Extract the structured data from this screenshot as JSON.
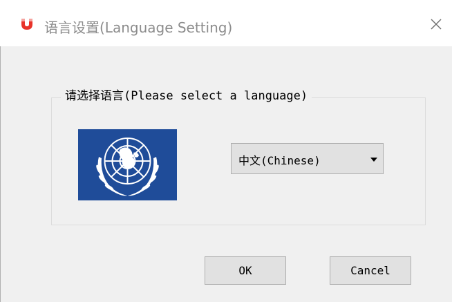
{
  "window": {
    "title": "语言设置(Language Setting)",
    "app_icon": "magnet-icon",
    "close_icon": "close-icon"
  },
  "group": {
    "label": "请选择语言(Please select a language)"
  },
  "flag": {
    "icon": "un-emblem-icon",
    "background_color": "#1f4c99"
  },
  "language_select": {
    "selected": "中文(Chinese)",
    "arrow_icon": "dropdown-arrow-icon"
  },
  "buttons": {
    "ok_label": "OK",
    "cancel_label": "Cancel"
  },
  "colors": {
    "dialog_bg": "#f0f0f0",
    "titlebar_bg": "#ffffff",
    "icon_red": "#e8332a",
    "button_bg": "#e1e1e1",
    "button_border": "#adadad"
  }
}
